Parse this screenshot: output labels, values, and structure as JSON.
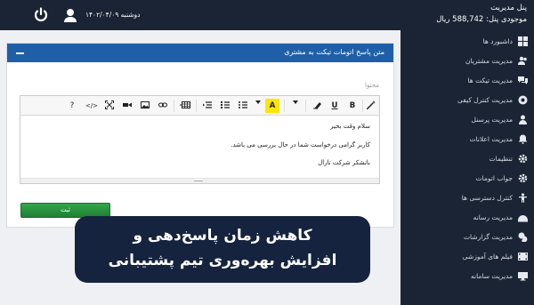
{
  "header": {
    "title": "پنل مدیریت",
    "balance": "موجودی پنل: 588,742 ریال",
    "date": "دوشنبه ۱۴۰۲/۰۴/۰۹"
  },
  "sidebar": {
    "items": [
      {
        "label": "داشبورد ها",
        "icon": "dashboard-icon"
      },
      {
        "label": "مدیریت مشتریان",
        "icon": "users-icon"
      },
      {
        "label": "مدیریت تیکت ها",
        "icon": "chat-icon"
      },
      {
        "label": "مدیریت کنترل کیفی",
        "icon": "quality-icon"
      },
      {
        "label": "مدیریت پرسنل",
        "icon": "staff-icon"
      },
      {
        "label": "مدیریت اعلانات",
        "icon": "bell-icon"
      },
      {
        "label": "تنظیمات",
        "icon": "gear-icon"
      },
      {
        "label": "جواب اتومات",
        "icon": "cog-icon"
      },
      {
        "label": "کنترل دسترسی ها",
        "icon": "access-icon"
      },
      {
        "label": "مدیریت رسانه",
        "icon": "media-icon"
      },
      {
        "label": "مدیریت گزارشات",
        "icon": "reports-icon"
      },
      {
        "label": "فیلم های آموزشی",
        "icon": "film-icon"
      },
      {
        "label": "مدیریت سامانه",
        "icon": "monitor-icon"
      }
    ]
  },
  "panel": {
    "title": "متن پاسخ اتومات تیکت به مشتری",
    "field_label": "محتوا",
    "save_label": "ثبت"
  },
  "editor": {
    "toolbar": [
      "?",
      "</>",
      "fullscreen",
      "video",
      "image",
      "link",
      "table",
      "indent",
      "ordered-list",
      "unordered-list",
      "color-dropdown",
      "A",
      "font-dropdown",
      "eraser",
      "U",
      "B",
      "magic"
    ],
    "lines": [
      "سلام وقت بخیر",
      "کاربر گرامی درخواست شما در حال بررسی می باشد.",
      "باتشکر شرکت تارال"
    ]
  },
  "promo": {
    "line1": "کاهش زمان پاسخ‌دهی و",
    "line2": "افزایش بهره‌وری تیم پشتیبانی"
  },
  "colors": {
    "navy": "#1b2434",
    "panel_header": "#1f5fa8",
    "save_green": "#2a9a40",
    "promo_bg": "#15233f"
  }
}
